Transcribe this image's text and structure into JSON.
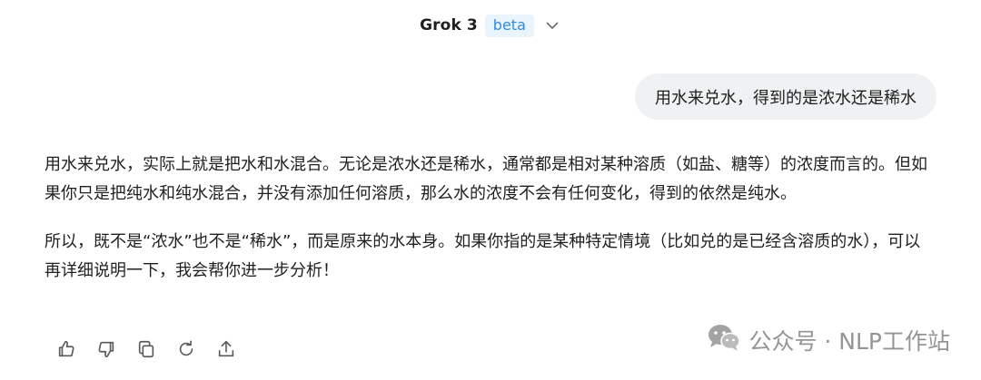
{
  "header": {
    "model_name": "Grok 3",
    "badge": "beta",
    "chevron_icon": "chevron-down-icon"
  },
  "conversation": {
    "user_message": "用水来兑水，得到的是浓水还是稀水",
    "assistant_paragraphs": [
      "用水来兑水，实际上就是把水和水混合。无论是浓水还是稀水，通常都是相对某种溶质（如盐、糖等）的浓度而言的。但如果你只是把纯水和纯水混合，并没有添加任何溶质，那么水的浓度不会有任何变化，得到的依然是纯水。",
      "所以，既不是“浓水”也不是“稀水”，而是原来的水本身。如果你指的是某种特定情境（比如兑的是已经含溶质的水），可以再详细说明一下，我会帮你进一步分析！"
    ]
  },
  "actions": [
    {
      "name": "thumbs-up-icon"
    },
    {
      "name": "thumbs-down-icon"
    },
    {
      "name": "copy-icon"
    },
    {
      "name": "regenerate-icon"
    },
    {
      "name": "share-icon"
    }
  ],
  "watermark": {
    "text": "公众号 · NLP工作站",
    "icon": "wechat-icon"
  },
  "colors": {
    "accent": "#2f8ae3",
    "badge_bg": "#eaf4fd",
    "bubble_bg": "#eff1f2",
    "text": "#1f1f1f",
    "icon": "#5b5b5b",
    "watermark": "#8a8a8a"
  }
}
